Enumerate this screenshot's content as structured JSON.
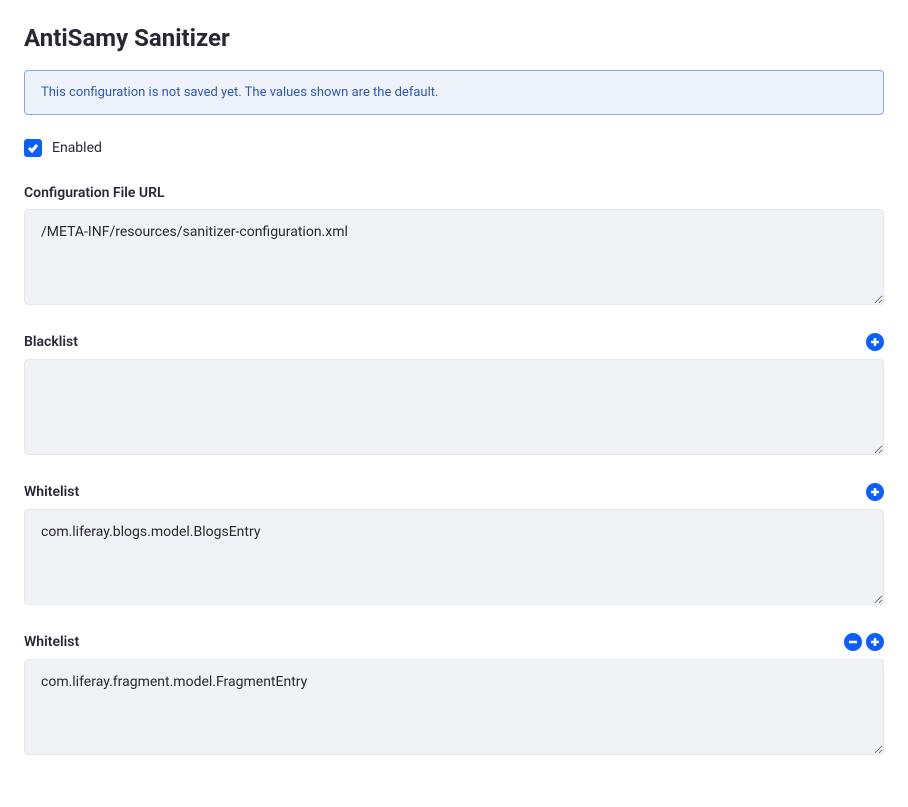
{
  "page": {
    "title": "AntiSamy Sanitizer"
  },
  "banner": {
    "text": "This configuration is not saved yet. The values shown are the default."
  },
  "enabled": {
    "label": "Enabled",
    "checked": true
  },
  "fields": {
    "configUrl": {
      "label": "Configuration File URL",
      "value": "/META-INF/resources/sanitizer-configuration.xml"
    },
    "blacklist": {
      "label": "Blacklist",
      "value": ""
    },
    "whitelist1": {
      "label": "Whitelist",
      "value": "com.liferay.blogs.model.BlogsEntry"
    },
    "whitelist2": {
      "label": "Whitelist",
      "value": "com.liferay.fragment.model.FragmentEntry"
    }
  }
}
